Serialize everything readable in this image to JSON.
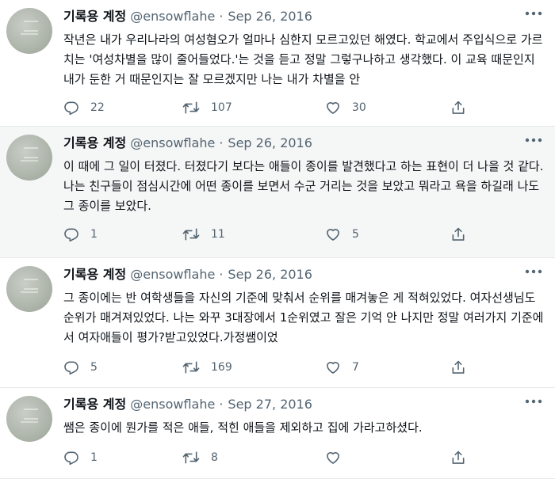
{
  "colors": {
    "text": "#0f1419",
    "secondary": "#536471",
    "highlight_background": "#f5f6f6",
    "divider": "#e6e9eb"
  },
  "icons": [
    "more-icon",
    "reply-icon",
    "retweet-icon",
    "like-icon",
    "share-icon"
  ],
  "tweets": [
    {
      "author": "기록용 계정",
      "handle": "@ensowflahe",
      "separator": "·",
      "date": "Sep 26, 2016",
      "text": "작년은 내가 우리나라의 여성혐오가 얼마나 심한지 모르고있던 해였다. 학교에서 주입식으로 가르치는 '여성차별을 많이 줄어들었다.'는 것을 듣고 정말 그렇구나하고 생각했다. 이 교육 때문인지 내가 둔한 거 때문인지는 잘 모르겠지만 나는 내가 차별을 안",
      "replies": "22",
      "retweets": "107",
      "likes": "30"
    },
    {
      "author": "기록용 계정",
      "handle": "@ensowflahe",
      "separator": "·",
      "date": "Sep 26, 2016",
      "text": "이 때에 그 일이 터졌다. 터졌다기 보다는 애들이 종이를 발견했다고 하는 표현이 더 나을 것 같다. 나는 친구들이 점심시간에 어떤 종이를 보면서 수군 거리는 것을 보았고 뭐라고 욕을 하길래 나도 그 종이를 보았다.",
      "replies": "1",
      "retweets": "11",
      "likes": "5"
    },
    {
      "author": "기록용 계정",
      "handle": "@ensowflahe",
      "separator": "·",
      "date": "Sep 26, 2016",
      "text": "그 종이에는 반 여학생들을 자신의 기준에 맞춰서 순위를 매겨놓은 게 적혀있었다. 여자선생님도 순위가 매겨져있었다. 나는 와꾸 3대장에서 1순위였고 잘은 기억 안 나지만 정말 여러가지 기준에서 여자애들이 평가?받고있었다.가정쌤이었",
      "replies": "5",
      "retweets": "169",
      "likes": "7"
    },
    {
      "author": "기록용 계정",
      "handle": "@ensowflahe",
      "separator": "·",
      "date": "Sep 27, 2016",
      "text": "쌤은 종이에 뭔가를 적은 애들, 적힌 애들을 제외하고 집에 가라고하셨다.",
      "replies": "1",
      "retweets": "8",
      "likes": "",
      "show_like_count": false
    }
  ]
}
